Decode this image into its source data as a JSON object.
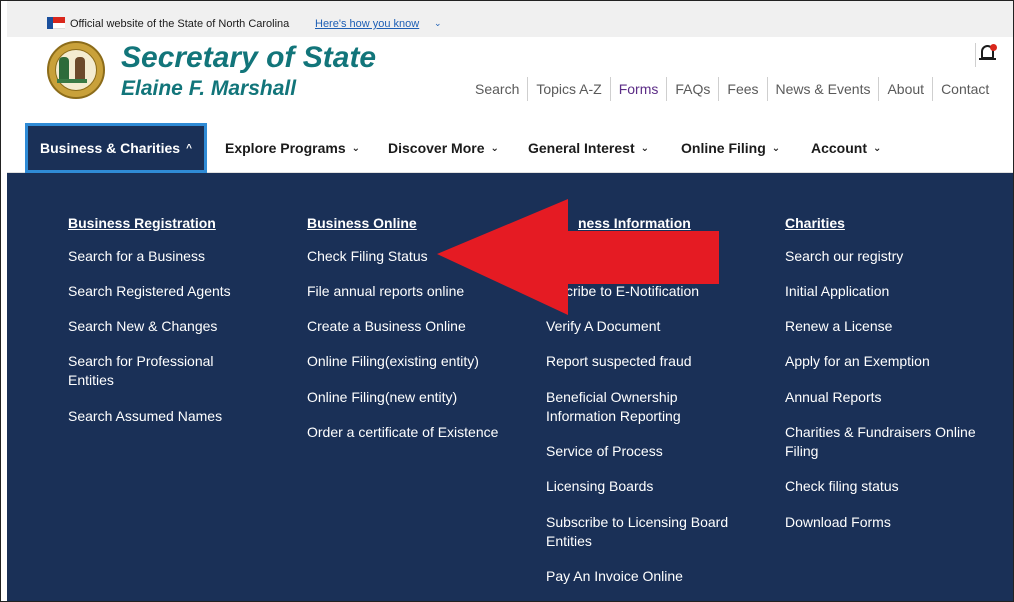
{
  "official_banner": {
    "text": "Official website of the State of North Carolina",
    "link": "Here's how you know"
  },
  "header": {
    "title": "Secretary of State",
    "subtitle": "Elaine F. Marshall"
  },
  "utility_nav": [
    "Search",
    "Topics A-Z",
    "Forms",
    "FAQs",
    "Fees",
    "News & Events",
    "About",
    "Contact"
  ],
  "main_nav": [
    {
      "label": "Business & Charities",
      "active": true
    },
    {
      "label": "Explore Programs"
    },
    {
      "label": "Discover More"
    },
    {
      "label": "General Interest"
    },
    {
      "label": "Online Filing"
    },
    {
      "label": "Account"
    }
  ],
  "mega_menu": {
    "columns": [
      {
        "heading": "Business Registration",
        "links": [
          "Search for a Business",
          "Search Registered Agents",
          "Search New & Changes",
          "Search for Professional Entities",
          "Search Assumed Names"
        ]
      },
      {
        "heading": "Business Online",
        "links": [
          "Check Filing Status",
          "File annual reports online",
          "Create a Business Online",
          "Online Filing(existing entity)",
          "Online Filing(new entity)",
          "Order a certificate of Existence"
        ]
      },
      {
        "heading": "Business Information",
        "heading_visible": "ness Information",
        "links": [
          "Subscribe to E-Notification",
          "Verify A Document",
          "Report suspected fraud",
          "Beneficial Ownership Information Reporting",
          "Service of Process",
          "Licensing Boards",
          "Subscribe to Licensing Board Entities",
          "Pay An Invoice Online"
        ],
        "first_link_visible": "cribe to E-Notification"
      },
      {
        "heading": "Charities",
        "links": [
          "Search our registry",
          "Initial Application",
          "Renew a License",
          "Apply for an Exemption",
          "Annual Reports",
          "Charities & Fundraisers Online Filing",
          "Check filing status",
          "Download Forms"
        ]
      }
    ]
  },
  "colors": {
    "brand_teal": "#12757a",
    "menu_navy": "#1a3057",
    "active_border": "#2f8bd6",
    "annotation_arrow": "#e51b23"
  }
}
